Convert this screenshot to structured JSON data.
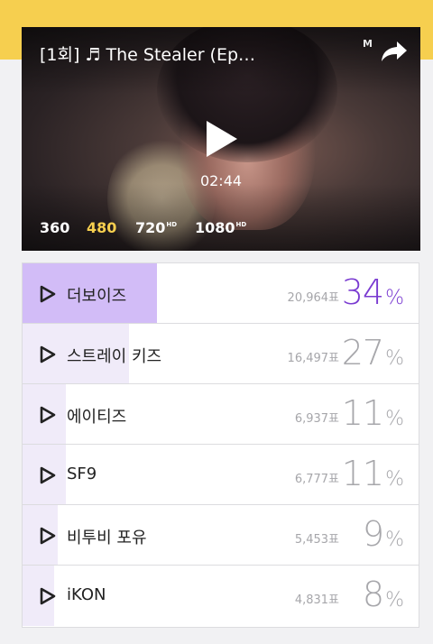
{
  "colors": {
    "accent_yellow": "#f6cf4f",
    "top_bar": "#d2bcf7",
    "bar": "#f0ebf9",
    "top_percent": "#7a3bd1"
  },
  "video": {
    "title": "[1회] ♬ The Stealer (Ep…",
    "brand": "M",
    "duration": "02:44",
    "qualities": [
      {
        "label": "360",
        "badge": "",
        "active": false
      },
      {
        "label": "480",
        "badge": "",
        "active": true
      },
      {
        "label": "720",
        "badge": "HD",
        "active": false
      },
      {
        "label": "1080",
        "badge": "HD",
        "active": false
      }
    ],
    "icons": {
      "share": "share-icon",
      "play": "play-icon"
    }
  },
  "vote_list": [
    {
      "name": "더보이즈",
      "votes": "20,964표",
      "percent": "34",
      "unit": "%",
      "share": 0.34
    },
    {
      "name": "스트레이 키즈",
      "votes": "16,497표",
      "percent": "27",
      "unit": "%",
      "share": 0.27
    },
    {
      "name": "에이티즈",
      "votes": "6,937표",
      "percent": "11",
      "unit": "%",
      "share": 0.11
    },
    {
      "name": "SF9",
      "votes": "6,777표",
      "percent": "11",
      "unit": "%",
      "share": 0.11
    },
    {
      "name": "비투비 포유",
      "votes": "5,453표",
      "percent": "9",
      "unit": "%",
      "share": 0.09
    },
    {
      "name": "iKON",
      "votes": "4,831표",
      "percent": "8",
      "unit": "%",
      "share": 0.08
    }
  ]
}
